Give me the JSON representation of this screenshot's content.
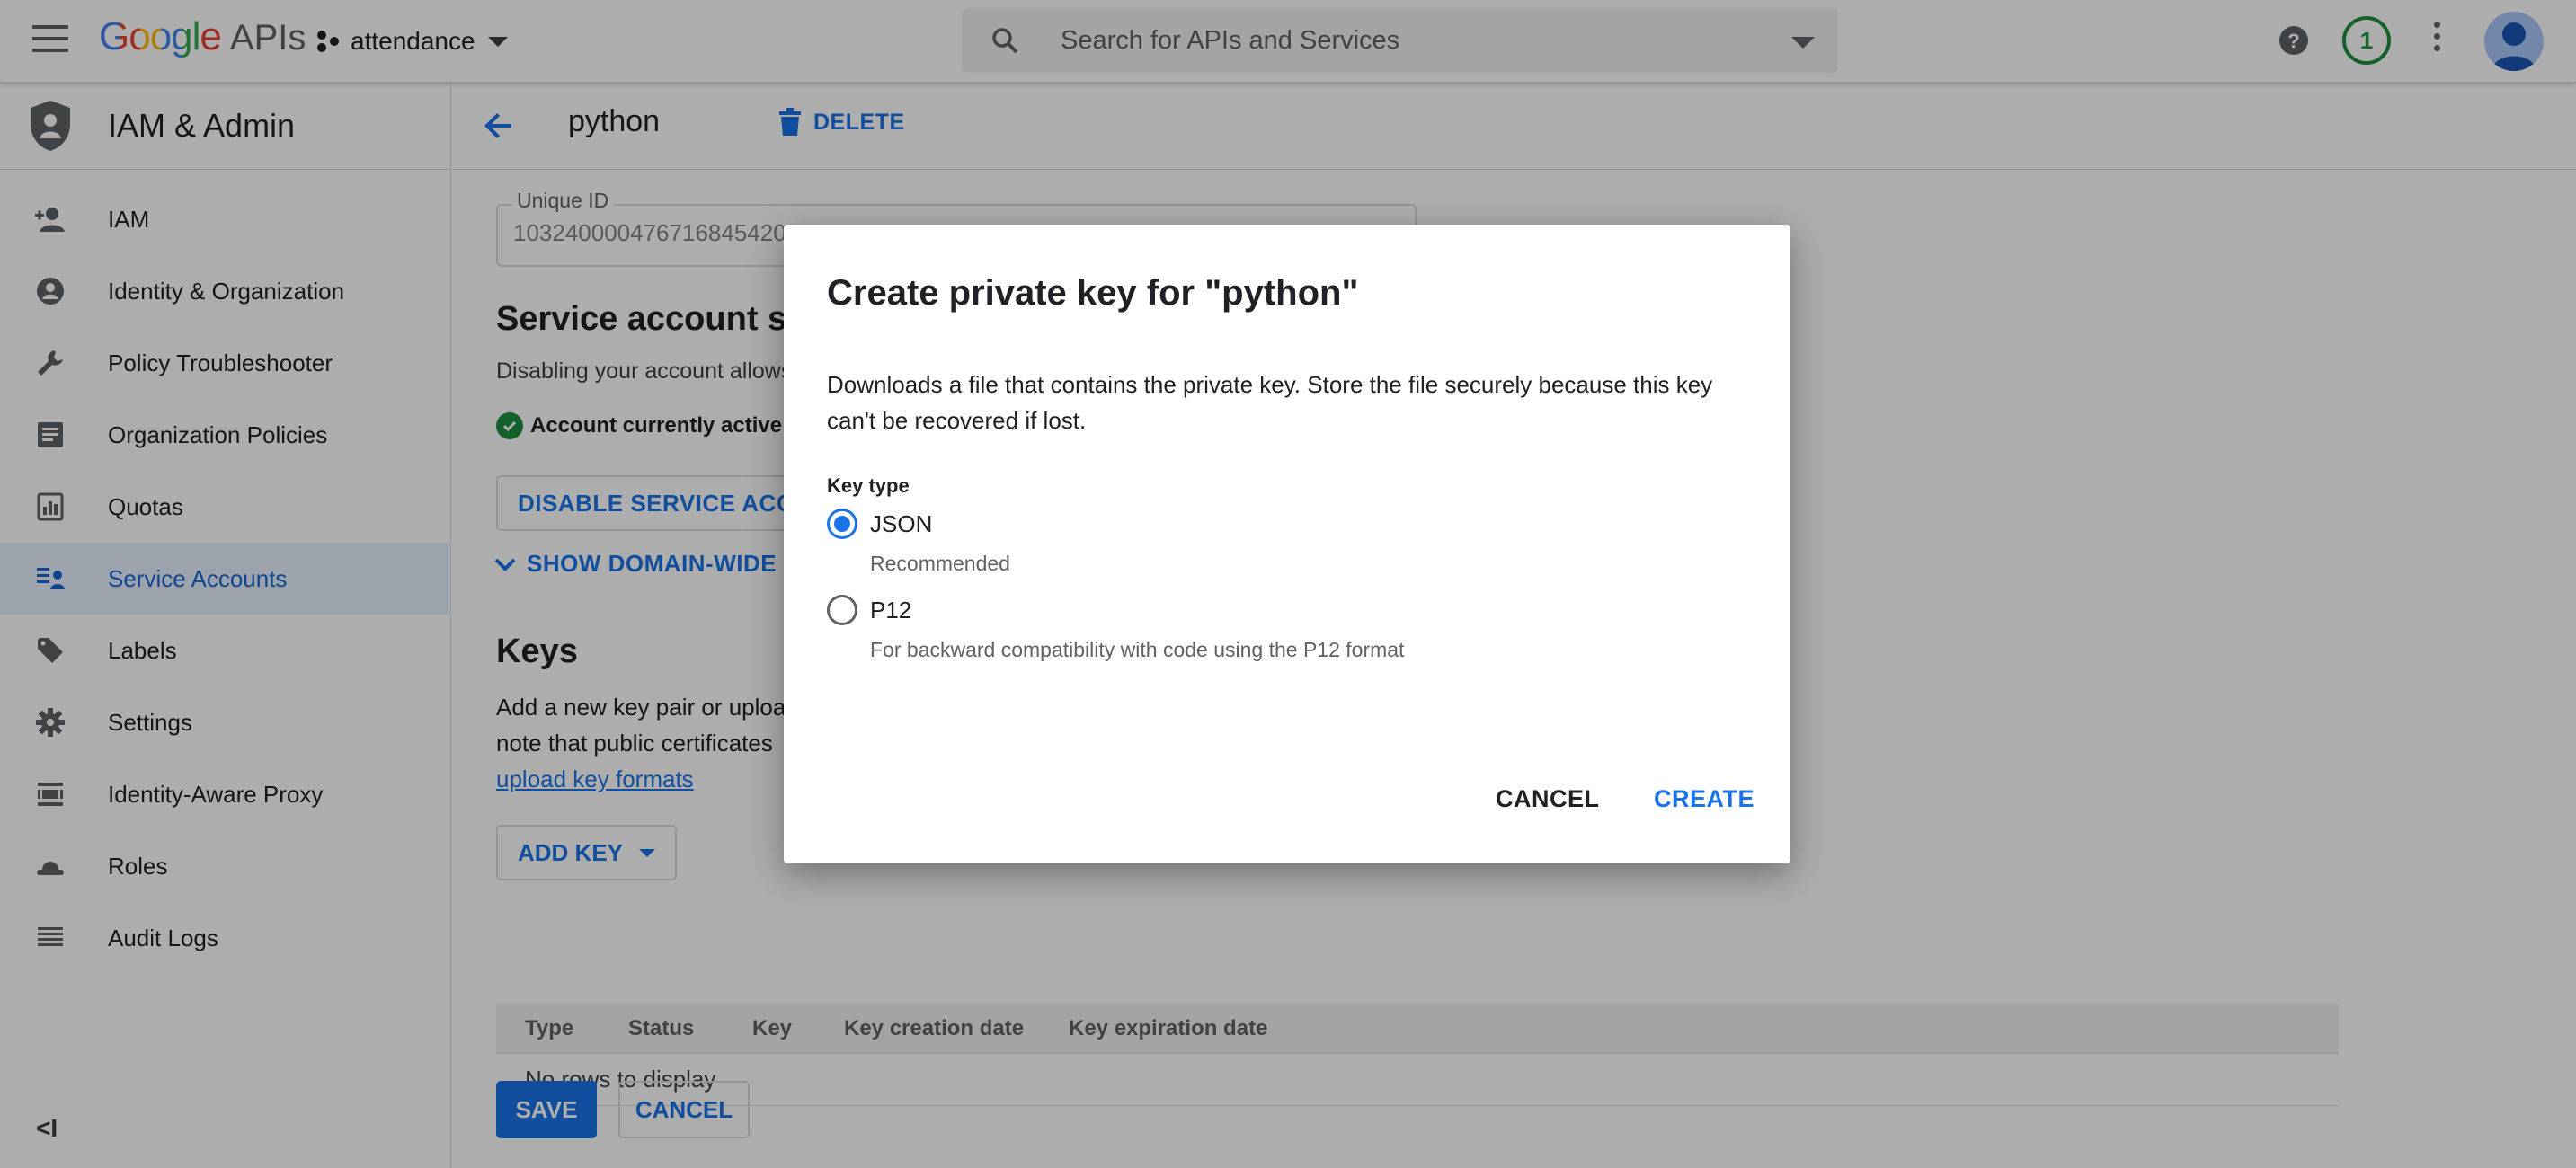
{
  "topbar": {
    "logo_google": "Google",
    "logo_apis": "APIs",
    "project_name": "attendance",
    "search_placeholder": "Search for APIs and Services",
    "notification_count": "1"
  },
  "colors": {
    "accent": "#1a73e8",
    "success": "#1e8e3e",
    "scrim": "rgba(0,0,0,0.32)"
  },
  "sidebar": {
    "title": "IAM & Admin",
    "items": [
      {
        "label": "IAM",
        "icon": "person-add-icon"
      },
      {
        "label": "Identity & Organization",
        "icon": "account-circle-icon"
      },
      {
        "label": "Policy Troubleshooter",
        "icon": "wrench-icon"
      },
      {
        "label": "Organization Policies",
        "icon": "document-icon"
      },
      {
        "label": "Quotas",
        "icon": "quota-icon"
      },
      {
        "label": "Service Accounts",
        "icon": "service-account-icon",
        "active": true
      },
      {
        "label": "Labels",
        "icon": "tag-icon"
      },
      {
        "label": "Settings",
        "icon": "gear-icon"
      },
      {
        "label": "Identity-Aware Proxy",
        "icon": "proxy-icon"
      },
      {
        "label": "Roles",
        "icon": "hat-icon"
      },
      {
        "label": "Audit Logs",
        "icon": "list-icon"
      }
    ],
    "collapse_glyph": "<I"
  },
  "main": {
    "title": "python",
    "delete_label": "DELETE",
    "unique_id_label": "Unique ID",
    "unique_id_value": "103240000476716845420",
    "status_heading": "Service account stat",
    "status_desc": "Disabling your account allows",
    "status_text": "Account currently active",
    "disable_button": "DISABLE SERVICE ACCOU",
    "show_dwd": "SHOW DOMAIN-WIDE DE",
    "keys_heading": "Keys",
    "keys_desc_1": "Add a new key pair or uploa",
    "keys_desc_2": "note that public certificates",
    "keys_link": "upload key formats",
    "add_key": "ADD KEY",
    "table": {
      "columns": [
        "Type",
        "Status",
        "Key",
        "Key creation date",
        "Key expiration date"
      ],
      "empty": "No rows to display"
    },
    "save": "SAVE",
    "cancel": "CANCEL"
  },
  "dialog": {
    "title": "Create private key for \"python\"",
    "body": "Downloads a file that contains the private key. Store the file securely because this key can't be recovered if lost.",
    "key_type_label": "Key type",
    "options": [
      {
        "label": "JSON",
        "sub": "Recommended",
        "selected": true
      },
      {
        "label": "P12",
        "sub": "For backward compatibility with code using the P12 format",
        "selected": false
      }
    ],
    "cancel": "CANCEL",
    "create": "CREATE"
  }
}
